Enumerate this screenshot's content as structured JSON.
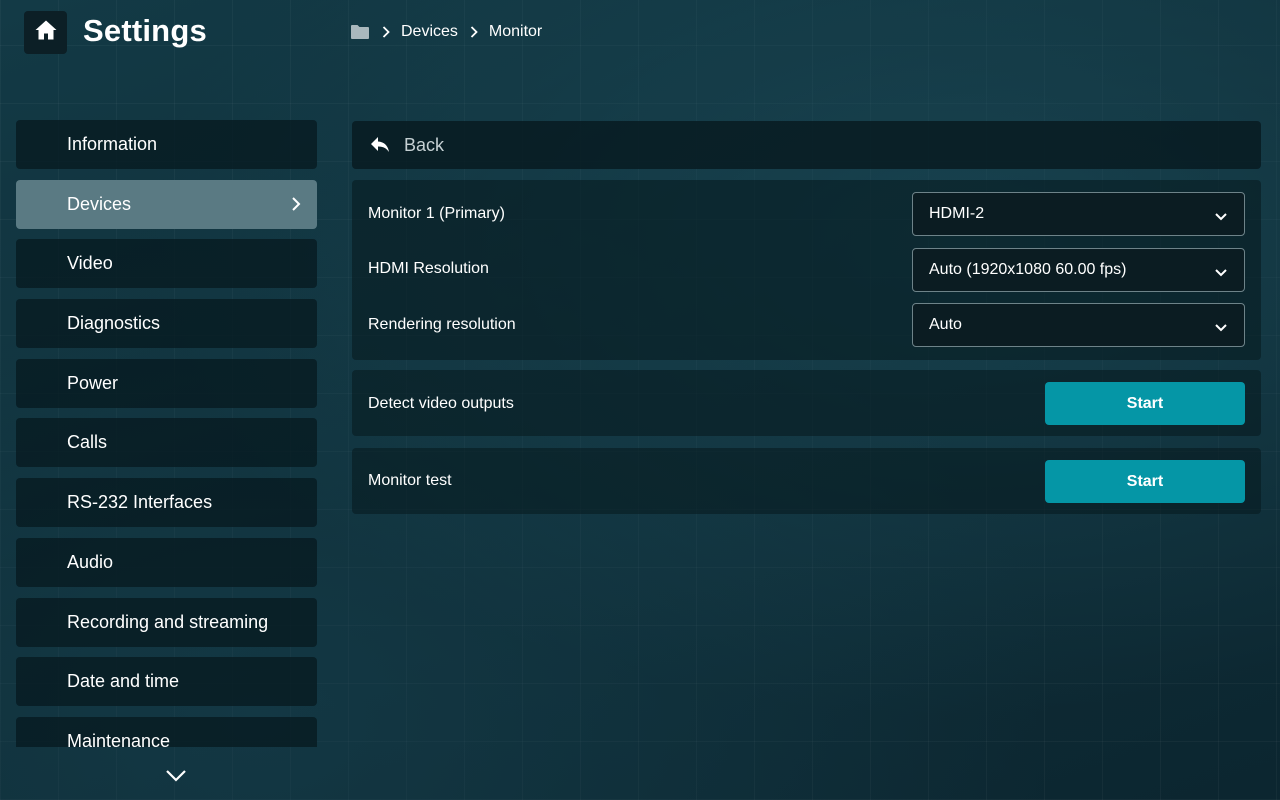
{
  "header": {
    "title": "Settings",
    "home_icon": "home-icon"
  },
  "breadcrumb": {
    "root_icon": "folder-icon",
    "items": [
      "Devices",
      "Monitor"
    ]
  },
  "sidebar": {
    "items": [
      {
        "label": "Information",
        "active": false
      },
      {
        "label": "Devices",
        "active": true
      },
      {
        "label": "Video",
        "active": false
      },
      {
        "label": "Diagnostics",
        "active": false
      },
      {
        "label": "Power",
        "active": false
      },
      {
        "label": "Calls",
        "active": false
      },
      {
        "label": "RS-232 Interfaces",
        "active": false
      },
      {
        "label": "Audio",
        "active": false
      },
      {
        "label": "Recording and streaming",
        "active": false
      },
      {
        "label": "Date and time",
        "active": false
      },
      {
        "label": "Maintenance",
        "active": false
      }
    ],
    "scroll_icon": "chevron-down-icon"
  },
  "main": {
    "back_label": "Back",
    "monitor_settings": [
      {
        "label": "Monitor 1 (Primary)",
        "value": "HDMI-2"
      },
      {
        "label": "HDMI Resolution",
        "value": "Auto (1920x1080 60.00 fps)"
      },
      {
        "label": "Rendering resolution",
        "value": "Auto"
      }
    ],
    "detect": {
      "label": "Detect video outputs",
      "button": "Start"
    },
    "monitor_test": {
      "label": "Monitor test",
      "button": "Start"
    }
  },
  "colors": {
    "background": "#0f2c36",
    "active_nav": "#5a7a83",
    "accent_button": "#0596a6"
  }
}
